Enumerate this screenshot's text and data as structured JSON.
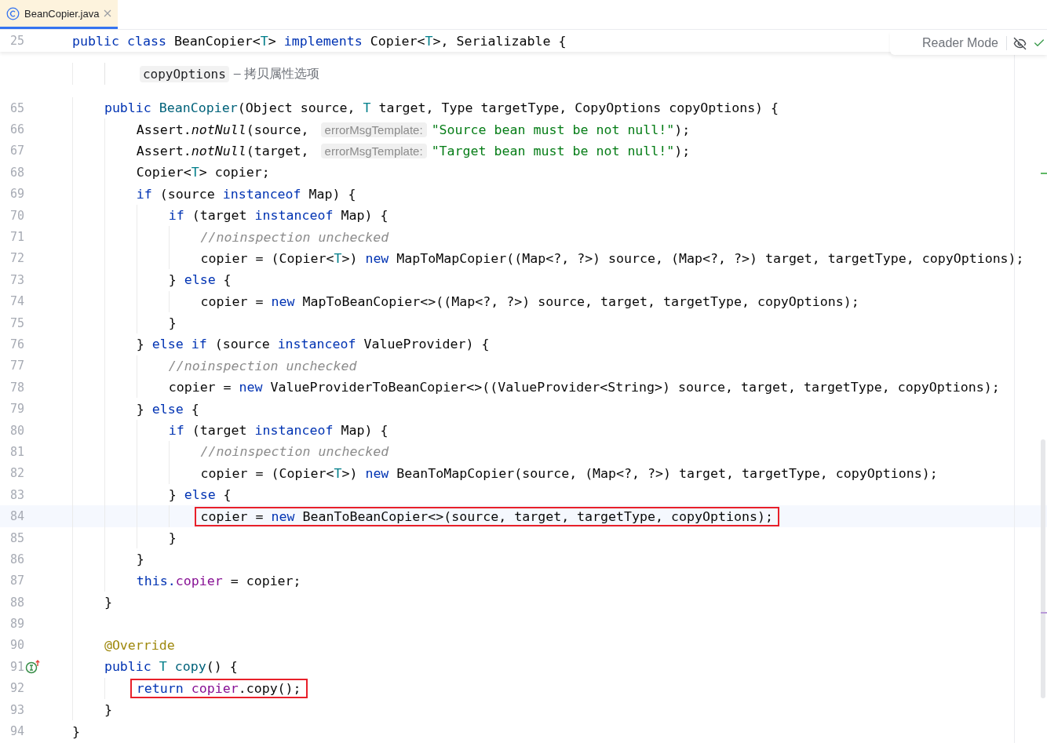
{
  "tabs": [
    {
      "label": "BeanCopier.java",
      "selected": true
    }
  ],
  "sticky_line": {
    "number": "25",
    "tokens": [
      {
        "t": "public class ",
        "kind": "kw"
      },
      {
        "t": "BeanCopier<",
        "kind": "plain"
      },
      {
        "t": "T",
        "kind": "tp"
      },
      {
        "t": "> ",
        "kind": "plain"
      },
      {
        "t": "implements",
        "kind": "kw"
      },
      {
        "t": " Copier<",
        "kind": "plain"
      },
      {
        "t": "T",
        "kind": "tp"
      },
      {
        "t": ">, Serializable {",
        "kind": "plain"
      }
    ]
  },
  "reader_mode": {
    "label": "Reader Mode"
  },
  "doc_param": {
    "name": "copyOptions",
    "description": "– 拷贝属性选项"
  },
  "class_body": [
    {
      "number": "65",
      "tokens": [
        {
          "t": "public ",
          "kind": "kw"
        },
        {
          "t": "BeanCopier",
          "kind": "fn"
        },
        {
          "t": "(Object source, ",
          "kind": "plain"
        },
        {
          "t": "T",
          "kind": "tp"
        },
        {
          "t": " target, Type targetType, CopyOptions copyOptions) {",
          "kind": "plain"
        }
      ],
      "children": [
        {
          "number": "66",
          "tokens": [
            {
              "t": "Assert.",
              "kind": "plain"
            },
            {
              "t": "notNull",
              "kind": "static"
            },
            {
              "t": "(source, ",
              "kind": "plain"
            },
            {
              "t": "errorMsgTemplate:",
              "kind": "hint"
            },
            {
              "t": "\"Source bean must be not null!\"",
              "kind": "str"
            },
            {
              "t": ");",
              "kind": "plain"
            }
          ]
        },
        {
          "number": "67",
          "tokens": [
            {
              "t": "Assert.",
              "kind": "plain"
            },
            {
              "t": "notNull",
              "kind": "static"
            },
            {
              "t": "(target, ",
              "kind": "plain"
            },
            {
              "t": "errorMsgTemplate:",
              "kind": "hint"
            },
            {
              "t": "\"Target bean must be not null!\"",
              "kind": "str"
            },
            {
              "t": ");",
              "kind": "plain"
            }
          ]
        },
        {
          "number": "68",
          "tokens": [
            {
              "t": "Copier<",
              "kind": "plain"
            },
            {
              "t": "T",
              "kind": "tp"
            },
            {
              "t": "> copier;",
              "kind": "plain"
            }
          ]
        },
        {
          "number": "69",
          "tokens": [
            {
              "t": "if",
              "kind": "kw"
            },
            {
              "t": " (source ",
              "kind": "plain"
            },
            {
              "t": "instanceof",
              "kind": "kw"
            },
            {
              "t": " Map) {",
              "kind": "plain"
            }
          ],
          "children": [
            {
              "number": "70",
              "tokens": [
                {
                  "t": "if",
                  "kind": "kw"
                },
                {
                  "t": " (target ",
                  "kind": "plain"
                },
                {
                  "t": "instanceof",
                  "kind": "kw"
                },
                {
                  "t": " Map) {",
                  "kind": "plain"
                }
              ],
              "children": [
                {
                  "number": "71",
                  "tokens": [
                    {
                      "t": "//noinspection unchecked",
                      "kind": "comment"
                    }
                  ]
                },
                {
                  "number": "72",
                  "tokens": [
                    {
                      "t": "copier = (Copier<",
                      "kind": "plain"
                    },
                    {
                      "t": "T",
                      "kind": "tp"
                    },
                    {
                      "t": ">) ",
                      "kind": "plain"
                    },
                    {
                      "t": "new",
                      "kind": "kw"
                    },
                    {
                      "t": " MapToMapCopier((Map<?, ?>) source, (Map<?, ?>) target, targetType, copyOptions);",
                      "kind": "plain"
                    }
                  ]
                }
              ]
            },
            {
              "number": "73",
              "tokens": [
                {
                  "t": "} ",
                  "kind": "plain"
                },
                {
                  "t": "else",
                  "kind": "kw"
                },
                {
                  "t": " {",
                  "kind": "plain"
                }
              ],
              "children": [
                {
                  "number": "74",
                  "tokens": [
                    {
                      "t": "copier = ",
                      "kind": "plain"
                    },
                    {
                      "t": "new",
                      "kind": "kw"
                    },
                    {
                      "t": " MapToBeanCopier<>((Map<?, ?>) source, target, targetType, copyOptions);",
                      "kind": "plain"
                    }
                  ]
                }
              ]
            },
            {
              "number": "75",
              "tokens": [
                {
                  "t": "}",
                  "kind": "plain"
                }
              ]
            }
          ]
        },
        {
          "number": "76",
          "tokens": [
            {
              "t": "} ",
              "kind": "plain"
            },
            {
              "t": "else if",
              "kind": "kw"
            },
            {
              "t": " (source ",
              "kind": "plain"
            },
            {
              "t": "instanceof",
              "kind": "kw"
            },
            {
              "t": " ValueProvider) {",
              "kind": "plain"
            }
          ],
          "children": [
            {
              "number": "77",
              "tokens": [
                {
                  "t": "//noinspection unchecked",
                  "kind": "comment"
                }
              ]
            },
            {
              "number": "78",
              "tokens": [
                {
                  "t": "copier = ",
                  "kind": "plain"
                },
                {
                  "t": "new",
                  "kind": "kw"
                },
                {
                  "t": " ValueProviderToBeanCopier<>((ValueProvider<String>) source, target, targetType, copyOptions);",
                  "kind": "plain"
                }
              ]
            }
          ]
        },
        {
          "number": "79",
          "tokens": [
            {
              "t": "} ",
              "kind": "plain"
            },
            {
              "t": "else",
              "kind": "kw"
            },
            {
              "t": " {",
              "kind": "plain"
            }
          ],
          "children": [
            {
              "number": "80",
              "tokens": [
                {
                  "t": "if",
                  "kind": "kw"
                },
                {
                  "t": " (target ",
                  "kind": "plain"
                },
                {
                  "t": "instanceof",
                  "kind": "kw"
                },
                {
                  "t": " Map) {",
                  "kind": "plain"
                }
              ],
              "children": [
                {
                  "number": "81",
                  "tokens": [
                    {
                      "t": "//noinspection unchecked",
                      "kind": "comment"
                    }
                  ]
                },
                {
                  "number": "82",
                  "tokens": [
                    {
                      "t": "copier = (Copier<",
                      "kind": "plain"
                    },
                    {
                      "t": "T",
                      "kind": "tp"
                    },
                    {
                      "t": ">) ",
                      "kind": "plain"
                    },
                    {
                      "t": "new",
                      "kind": "kw"
                    },
                    {
                      "t": " BeanToMapCopier(source, (Map<?, ?>) target, targetType, copyOptions);",
                      "kind": "plain"
                    }
                  ]
                }
              ]
            },
            {
              "number": "83",
              "tokens": [
                {
                  "t": "} ",
                  "kind": "plain"
                },
                {
                  "t": "else",
                  "kind": "kw"
                },
                {
                  "t": " {",
                  "kind": "plain"
                }
              ],
              "children": [
                {
                  "number": "84",
                  "current": true,
                  "boxed": true,
                  "tokens": [
                    {
                      "t": "copier = ",
                      "kind": "plain"
                    },
                    {
                      "t": "new",
                      "kind": "kw"
                    },
                    {
                      "t": " BeanToBeanCopier<>(source, target, targetType, copyOptions);",
                      "kind": "plain"
                    }
                  ]
                }
              ]
            },
            {
              "number": "85",
              "tokens": [
                {
                  "t": "}",
                  "kind": "plain"
                }
              ]
            }
          ]
        },
        {
          "number": "86",
          "tokens": [
            {
              "t": "}",
              "kind": "plain"
            }
          ]
        },
        {
          "number": "87",
          "tokens": [
            {
              "t": "this.",
              "kind": "kw"
            },
            {
              "t": "copier",
              "kind": "field"
            },
            {
              "t": " = copier;",
              "kind": "plain"
            }
          ]
        }
      ]
    },
    {
      "number": "88",
      "tokens": [
        {
          "t": "}",
          "kind": "plain"
        }
      ]
    },
    {
      "number": "89"
    },
    {
      "number": "90",
      "tokens": [
        {
          "t": "@Override",
          "kind": "annotation"
        }
      ]
    },
    {
      "number": "91",
      "gutter_marker": true,
      "tokens": [
        {
          "t": "public ",
          "kind": "kw"
        },
        {
          "t": "T ",
          "kind": "tp"
        },
        {
          "t": "copy",
          "kind": "fn"
        },
        {
          "t": "() {",
          "kind": "plain"
        }
      ],
      "children": [
        {
          "number": "92",
          "boxed": true,
          "tokens": [
            {
              "t": "return ",
              "kind": "kw"
            },
            {
              "t": "copier",
              "kind": "field"
            },
            {
              "t": ".copy();",
              "kind": "plain"
            }
          ]
        }
      ]
    },
    {
      "number": "93",
      "tokens": [
        {
          "t": "}",
          "kind": "plain"
        }
      ]
    }
  ],
  "last_line": {
    "number": "94",
    "tokens": [
      {
        "t": "}",
        "kind": "plain"
      }
    ]
  }
}
